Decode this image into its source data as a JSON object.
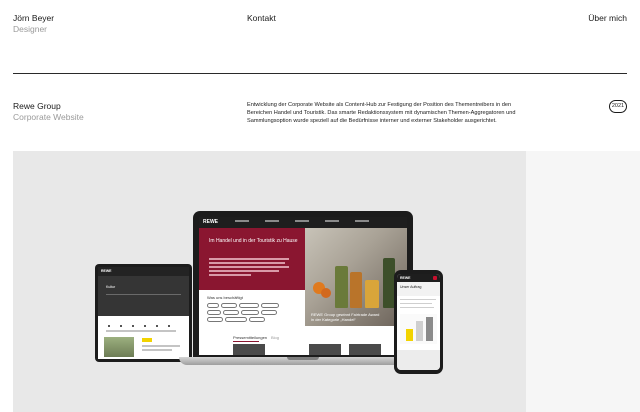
{
  "header": {
    "name": "Jörn Beyer",
    "role": "Designer",
    "nav": {
      "contact": "Kontakt",
      "about": "Über mich"
    }
  },
  "project": {
    "title": "Rewe Group",
    "subtitle": "Corporate Website",
    "description": "Entwicklung der Corporate Website als Content-Hub zur Festigung der Position des Thementreibers in den Bereichen Handel und Touristik. Das smarte Redaktionssystem mit dynamischen Themen-Aggregatoren und Sammlungsoption wurde speziell auf die Bedürfnisse interner und externer Stakeholder ausgerichtet.",
    "year": "2021"
  },
  "mockup": {
    "laptop": {
      "logo": "REWE",
      "hero_title": "Im Handel und in der Touristik zu Hause",
      "interest_label": "Was uns beschäftigt",
      "caption": "REWE Group gewinnt Fairtrade Award in der Kategorie „Handel“",
      "tab_active": "Pressemitteilungen",
      "tab_inactive": "Blog"
    },
    "tablet": {
      "logo": "REWE",
      "title": "Kultur"
    },
    "phone": {
      "logo": "REWE",
      "title": "Unser Auftrag"
    }
  },
  "colors": {
    "brand_red": "#8a1630",
    "accent_red": "#c8102e",
    "stage_bg": "#e8e8e8",
    "highlight_yellow": "#f2d300"
  }
}
